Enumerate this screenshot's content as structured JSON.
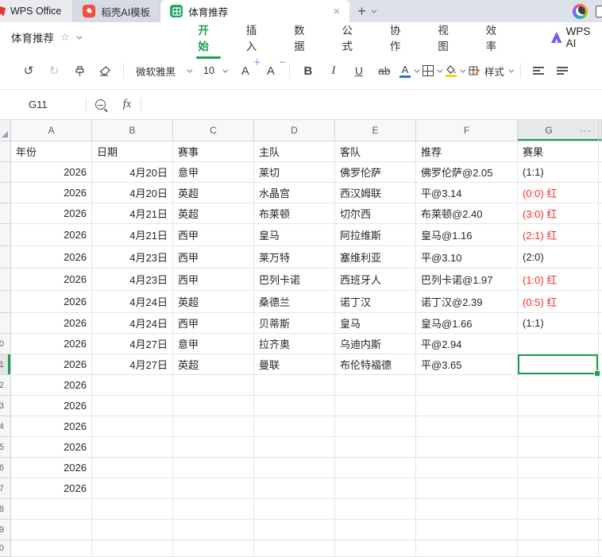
{
  "tabbar": {
    "home_tab_label": "WPS Office",
    "doc_tabs": [
      {
        "label": "稻壳AI模板",
        "icon": "daoke-icon",
        "active": false
      },
      {
        "label": "体育推荐",
        "icon": "spreadsheet-icon",
        "active": true
      }
    ],
    "close_label": "×",
    "new_tab_label": "+"
  },
  "menubar": {
    "doc_title": "体育推荐",
    "items": [
      "开始",
      "插入",
      "数据",
      "公式",
      "协作",
      "视图",
      "效率"
    ],
    "active_item": "开始",
    "wps_ai_label": "WPS AI"
  },
  "toolbar": {
    "font_name": "微软雅黑",
    "font_size": "10",
    "bold_label": "B",
    "italic_label": "I",
    "underline_label": "U",
    "strikethrough_label": "ab",
    "font_color_label": "A",
    "grow_font_label": "A",
    "shrink_font_label": "A",
    "styles_label": "样式",
    "font_color": "#2c6fe0",
    "fill_color": "#f7d514"
  },
  "formula_bar": {
    "name_box": "G11",
    "fx_label": "fx"
  },
  "sheet": {
    "column_letters": [
      "A",
      "B",
      "C",
      "D",
      "E",
      "F",
      "G"
    ],
    "selected_column": "G",
    "overflow_menu_label": "···",
    "header_row": [
      "年份",
      "日期",
      "赛事",
      "主队",
      "客队",
      "推荐",
      "赛果"
    ],
    "selected_cell": "G11",
    "accent_green": "#1d9e53",
    "result_red_color": "#f23030",
    "rows": [
      {
        "cells": [
          "2026",
          "4月20日",
          "意甲",
          "莱切",
          "佛罗伦萨",
          "佛罗伦萨@2.05",
          "(1:1)"
        ],
        "red": false
      },
      {
        "cells": [
          "2026",
          "4月20日",
          "英超",
          "水晶宫",
          "西汉姆联",
          "平@3.14",
          "(0:0) 红"
        ],
        "red": true
      },
      {
        "cells": [
          "2026",
          "4月21日",
          "英超",
          "布莱顿",
          "切尔西",
          "布莱顿@2.40",
          "(3:0) 红"
        ],
        "red": true
      },
      {
        "cells": [
          "2026",
          "4月21日",
          "西甲",
          "皇马",
          "阿拉维斯",
          "皇马@1.16",
          "(2:1) 红"
        ],
        "red": true
      },
      {
        "cells": [
          "2026",
          "4月23日",
          "西甲",
          "莱万特",
          "塞维利亚",
          "平@3.10",
          "(2:0)"
        ],
        "red": false
      },
      {
        "cells": [
          "2026",
          "4月23日",
          "西甲",
          "巴列卡诺",
          "西班牙人",
          "巴列卡诺@1.97",
          "(1:0) 红"
        ],
        "red": true
      },
      {
        "cells": [
          "2026",
          "4月24日",
          "英超",
          "桑德兰",
          "诺丁汉",
          "诺丁汉@2.39",
          "(0:5) 红"
        ],
        "red": true
      },
      {
        "cells": [
          "2026",
          "4月24日",
          "西甲",
          "贝蒂斯",
          "皇马",
          "皇马@1.66",
          "(1:1)"
        ],
        "red": false
      },
      {
        "cells": [
          "2026",
          "4月27日",
          "意甲",
          "拉齐奥",
          "乌迪内斯",
          "平@2.94",
          ""
        ],
        "red": false
      },
      {
        "cells": [
          "2026",
          "4月27日",
          "英超",
          "曼联",
          "布伦特福德",
          "平@3.65",
          ""
        ],
        "red": false,
        "selected": true
      },
      {
        "cells": [
          "2026",
          "",
          "",
          "",
          "",
          "",
          ""
        ],
        "red": false
      },
      {
        "cells": [
          "2026",
          "",
          "",
          "",
          "",
          "",
          ""
        ],
        "red": false
      },
      {
        "cells": [
          "2026",
          "",
          "",
          "",
          "",
          "",
          ""
        ],
        "red": false
      },
      {
        "cells": [
          "2026",
          "",
          "",
          "",
          "",
          "",
          ""
        ],
        "red": false
      },
      {
        "cells": [
          "2026",
          "",
          "",
          "",
          "",
          "",
          ""
        ],
        "red": false
      },
      {
        "cells": [
          "2026",
          "",
          "",
          "",
          "",
          "",
          ""
        ],
        "red": false
      },
      {
        "cells": [
          "",
          "",
          "",
          "",
          "",
          "",
          ""
        ],
        "red": false
      },
      {
        "cells": [
          "",
          "",
          "",
          "",
          "",
          "",
          ""
        ],
        "red": false
      },
      {
        "cells": [
          "",
          "",
          "",
          "",
          "",
          "",
          ""
        ],
        "red": false
      }
    ]
  }
}
